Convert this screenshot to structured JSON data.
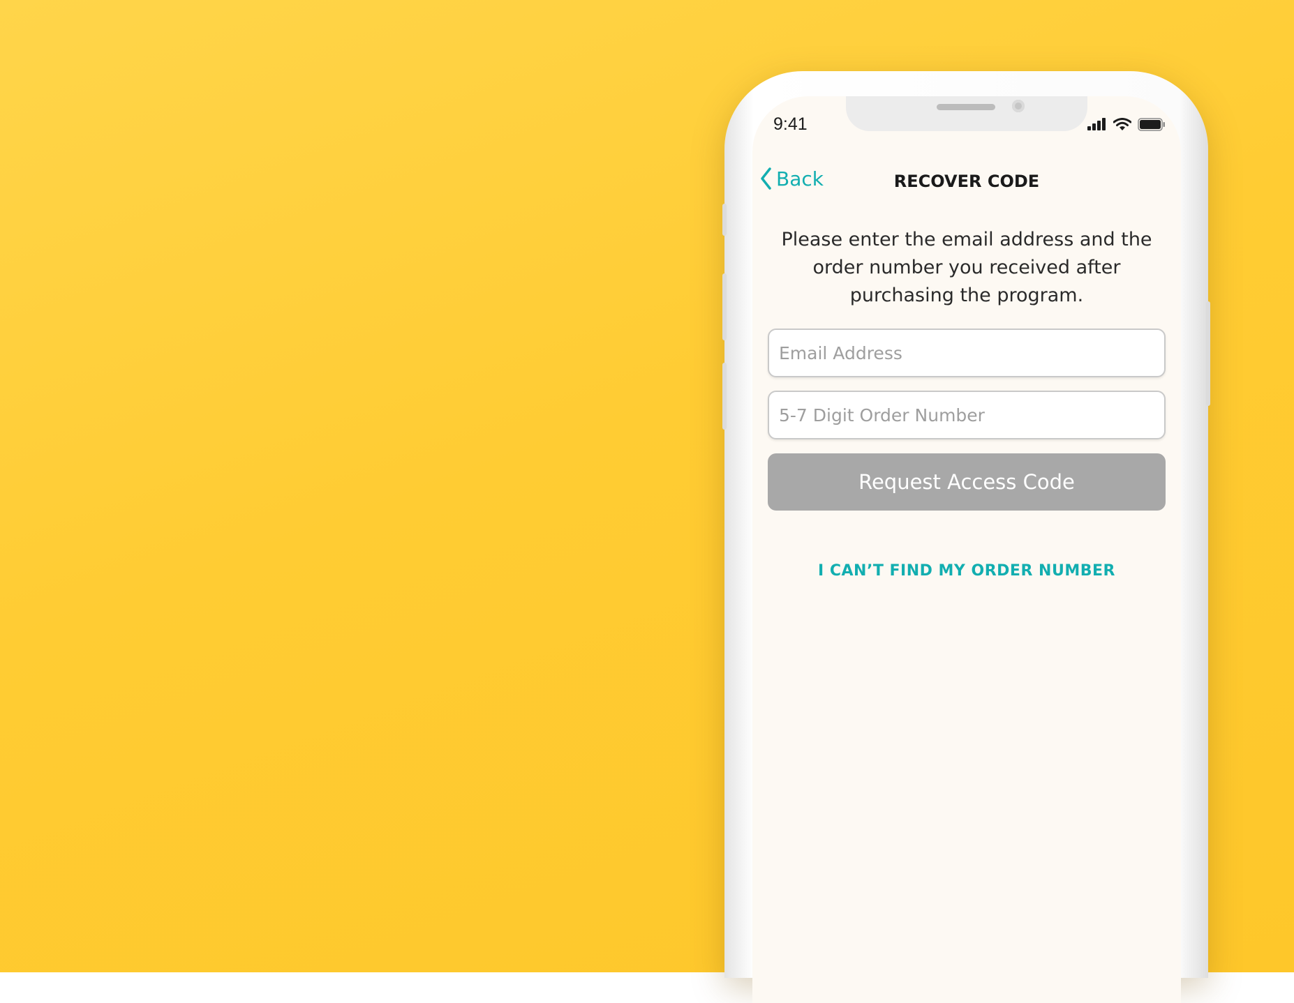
{
  "status_bar": {
    "time": "9:41",
    "icons": [
      "cellular-signal-icon",
      "wifi-icon",
      "battery-icon"
    ]
  },
  "nav": {
    "back_label": "Back",
    "back_icon": "chevron-left-icon",
    "title": "RECOVER CODE"
  },
  "instructions": "Please enter the email address and the order number you received after purchasing the program.",
  "form": {
    "email_placeholder": "Email Address",
    "email_value": "",
    "order_placeholder": "5-7 Digit Order Number",
    "order_value": "",
    "submit_label": "Request Access Code"
  },
  "help_link": "I CAN’T FIND MY ORDER NUMBER",
  "colors": {
    "background": "#ffcc33",
    "accent": "#12aeb0",
    "button_disabled": "#a8a8a8",
    "screen": "#fdf9f3"
  }
}
